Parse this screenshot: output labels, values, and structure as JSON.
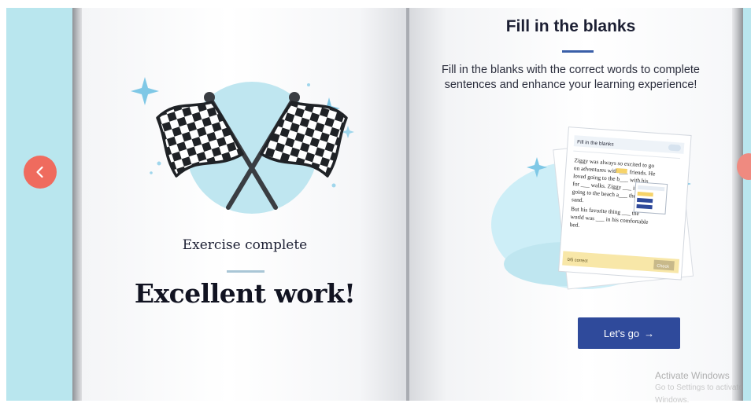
{
  "left_page": {
    "exercise_status": "Exercise complete",
    "headline": "Excellent work!"
  },
  "right_page": {
    "title": "Fill in the blanks",
    "description": "Fill in the blanks with the correct words to complete sentences and enhance your learning experience!",
    "cta_label": "Let's go",
    "cta_arrow": "→"
  },
  "worksheet_preview": {
    "header": "Fill in the blanks",
    "lines": [
      "Ziggy was always so excited to go",
      "on adventures with ___ friends. He",
      "loved going to the b___ with his",
      "for ___ walks. Ziggy ___ ing",
      "going to the beach a___ the",
      "sand.",
      "But his favorite thing ___ the",
      "world was ___ in his comfortable",
      "bed."
    ],
    "footer_left": "0/5 correct",
    "footer_right": "Check"
  },
  "navigation": {
    "prev_icon": "chevron-left-icon",
    "next_icon": "chevron-right-icon"
  },
  "watermark": {
    "line1": "Activate Windows",
    "line2": "Go to Settings to activate Windows."
  },
  "colors": {
    "background": "#b9e6ee",
    "nav_button": "#ef6b5e",
    "primary_button": "#2f4a9b",
    "accent_light_blue": "#bfe6f0",
    "sparkle": "#7fc8e6"
  }
}
